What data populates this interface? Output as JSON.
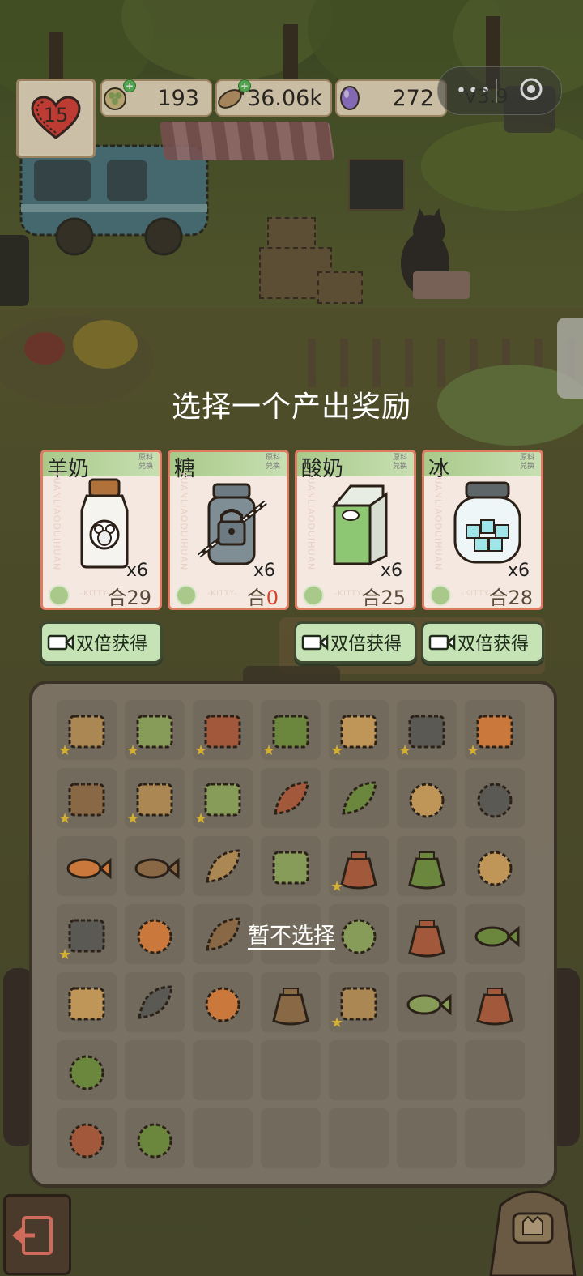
{
  "hud": {
    "hearts": "15",
    "resources": [
      {
        "icon": "clover-coin-icon",
        "value": "193"
      },
      {
        "icon": "fish-biscuit-icon",
        "value": "36.06k"
      },
      {
        "icon": "purple-gem-icon",
        "value": "272"
      }
    ],
    "version": "V3.9",
    "menu_dots": "•••"
  },
  "overlay": {
    "title": "选择一个产出奖励",
    "skip_label": "暂不选择"
  },
  "cards": [
    {
      "name": "羊奶",
      "tag": "原料 兑换",
      "side": "YUANLIAODUIHUAN",
      "mult": "x6",
      "count": "29",
      "icon": "goat-milk-bottle-icon",
      "double_label": "双倍获得",
      "has_double": true
    },
    {
      "name": "糖",
      "tag": "原料 兑换",
      "side": "YUANLIAODUIHUAN",
      "mult": "x6",
      "count": "0",
      "icon": "locked-sugar-jar-icon",
      "double_label": "",
      "has_double": false
    },
    {
      "name": "酸奶",
      "tag": "原料 兑换",
      "side": "YUANLIAODUIHUAN",
      "mult": "x6",
      "count": "25",
      "icon": "yogurt-carton-icon",
      "double_label": "双倍获得",
      "has_double": true
    },
    {
      "name": "冰",
      "tag": "原料 兑换",
      "side": "YUANLIAODUIHUAN",
      "mult": "x6",
      "count": "28",
      "icon": "ice-jar-icon",
      "double_label": "双倍获得",
      "has_double": true
    }
  ],
  "card_footer": {
    "watermark": "-KITTY-",
    "count_prefix": "合"
  },
  "colors": {
    "card_border": "#e07b63",
    "card_band": "#a9c98a",
    "button_bg": "#c6e3b6",
    "panel_bg": "#7c7366"
  },
  "inventory": {
    "rows": [
      [
        "cans-icon",
        "rolls-icon",
        "tomato-basket-icon",
        "rolls-icon",
        "bread-box-icon",
        "bread-box-icon",
        "bread-box-icon"
      ],
      [
        "rolls-green-icon",
        "vegetable-crate-icon",
        "vegetable-crate-icon",
        "scallion-icon",
        "lily-pad-icon",
        "dragon-fruit-icon",
        "wheat-bundle-icon"
      ],
      [
        "small-fish-icon",
        "big-fish-icon",
        "cabbage-icon",
        "potato-icon",
        "dark-sack-icon",
        "grain-sack-icon",
        "mushroom-bunch-icon"
      ],
      [
        "rolls-green-icon",
        "cookie-icon",
        "herb-icon",
        "",
        "ginger-icon",
        "seed-packet-icon",
        "dried-fish-icon"
      ],
      [
        "treasure-box-icon",
        "clover-icon",
        "pea-icon",
        "bucket-icon",
        "flower-pot-icon",
        "shrimp-icon",
        "dark-pouch-icon"
      ],
      [
        "snail-shell-icon",
        "",
        "",
        "",
        "",
        "",
        ""
      ],
      [
        "sheep-wool-icon",
        "frog-icon",
        "",
        "",
        "",
        "",
        ""
      ]
    ],
    "starred": [
      [
        0,
        0
      ],
      [
        0,
        1
      ],
      [
        0,
        2
      ],
      [
        0,
        3
      ],
      [
        0,
        4
      ],
      [
        0,
        5
      ],
      [
        0,
        6
      ],
      [
        1,
        0
      ],
      [
        1,
        1
      ],
      [
        1,
        2
      ],
      [
        2,
        4
      ],
      [
        3,
        0
      ],
      [
        4,
        4
      ]
    ]
  }
}
